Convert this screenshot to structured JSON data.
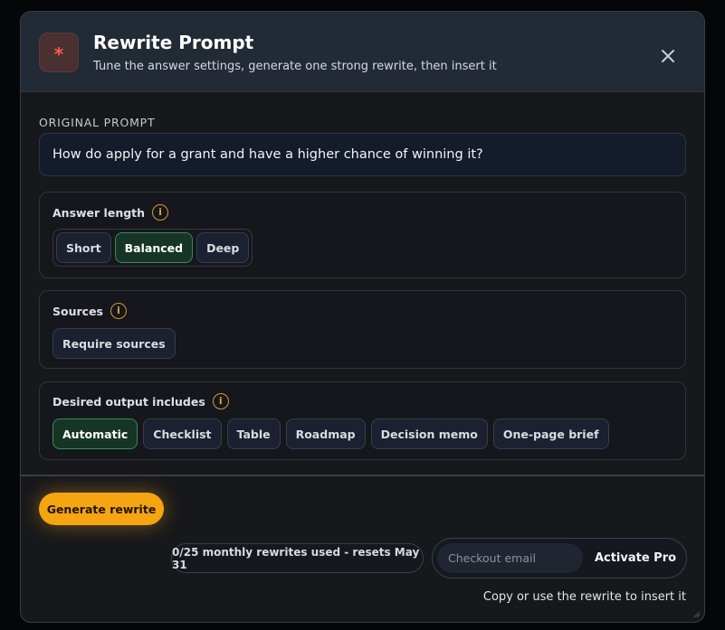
{
  "header": {
    "logo_symbol": "*",
    "title": "Rewrite Prompt",
    "subtitle": "Tune the answer settings, generate one strong rewrite, then insert it",
    "close_icon": "close-icon"
  },
  "original_prompt": {
    "label": "ORIGINAL PROMPT",
    "value": "How do apply for a grant and have a higher chance of winning it?"
  },
  "answer_length": {
    "label": "Answer length",
    "info_glyph": "i",
    "options": [
      "Short",
      "Balanced",
      "Deep"
    ],
    "selected": "Balanced"
  },
  "sources": {
    "label": "Sources",
    "info_glyph": "i",
    "options": [
      "Require sources"
    ],
    "selected": ""
  },
  "desired_output": {
    "label": "Desired output includes",
    "info_glyph": "i",
    "options": [
      "Automatic",
      "Checklist",
      "Table",
      "Roadmap",
      "Decision memo",
      "One-page brief"
    ],
    "selected": "Automatic"
  },
  "footer": {
    "generate_label": "Generate rewrite",
    "usage_text": "0/25 monthly rewrites used - resets May 31",
    "email_placeholder": "Checkout email",
    "activate_label": "Activate Pro",
    "hint": "Copy or use the rewrite to insert it"
  },
  "colors": {
    "accent_orange": "#f5a412",
    "selected_green": "#163526",
    "selected_border": "#3a8a5c",
    "logo_red": "#ff5a4a",
    "info_amber": "#d39a2a"
  }
}
